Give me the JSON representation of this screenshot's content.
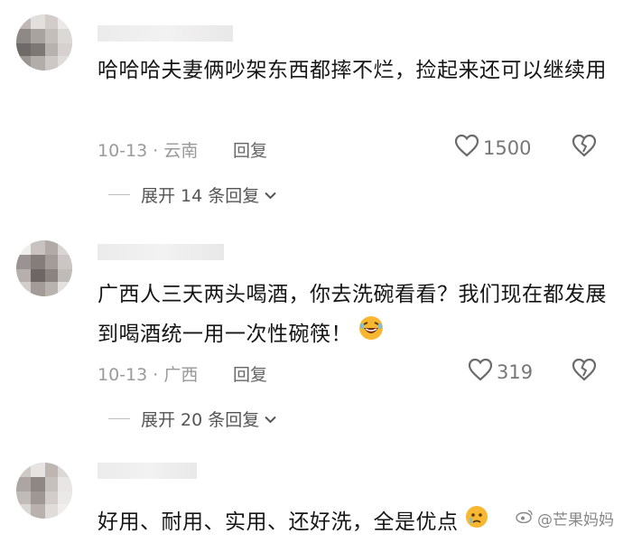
{
  "comments": [
    {
      "text": "哈哈哈夫妻俩吵架东西都摔不烂，捡起来还可以继续用",
      "time_location": "10-13 · 云南",
      "reply_label": "回复",
      "likes": "1500",
      "expand_label": "展开 14 条回复"
    },
    {
      "text": "广西人三天两头喝酒，你去洗碗看看？我们现在都发展到喝酒统一用一次性碗筷！",
      "time_location": "10-13 · 广西",
      "reply_label": "回复",
      "likes": "319",
      "expand_label": "展开 20 条回复"
    },
    {
      "text": "好用、耐用、实用、还好洗，全是优点"
    }
  ],
  "watermark": "@芒果妈妈",
  "icons": {
    "like": "heart-outline-icon",
    "dislike": "broken-heart-icon",
    "expand": "chevron-down-icon",
    "emoji_laugh": "laughing-emoji-icon",
    "emoji_cry": "crying-emoji-icon",
    "watermark": "weibo-logo-icon"
  },
  "colors": {
    "text": "#161616",
    "meta": "#9a9a9a",
    "accent_emoji": "#f7b731"
  }
}
